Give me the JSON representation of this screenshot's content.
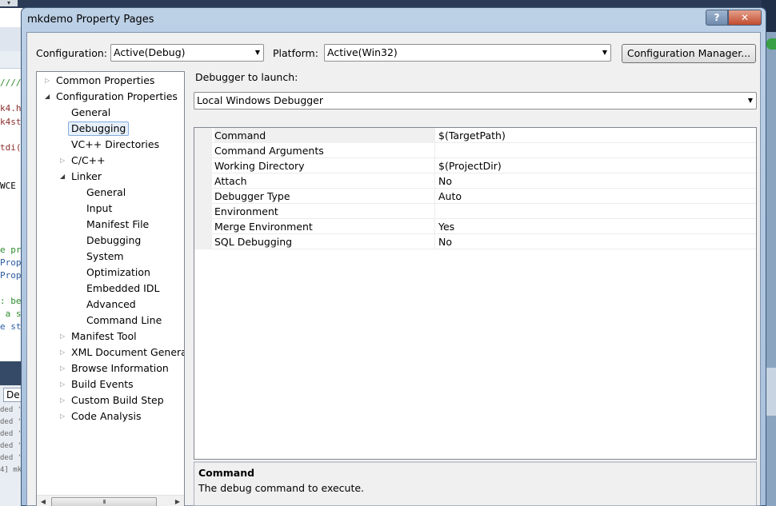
{
  "background": {
    "arrow": "▾",
    "code_lines": [
      "////",
      "k4.h",
      "k4st",
      "tdi(",
      "WCE",
      "e pr",
      "Prop",
      "Prop",
      ": be",
      " a s",
      "e st"
    ],
    "output_lines": [
      "ded '",
      "ded '",
      "ded '",
      "ded '",
      "ded '",
      "4] mk"
    ],
    "output_combo": "De"
  },
  "dialog": {
    "title": "mkdemo Property Pages",
    "help_label": "?",
    "close_label": "✕"
  },
  "config": {
    "configuration_label": "Configuration:",
    "configuration_value": "Active(Debug)",
    "platform_label": "Platform:",
    "platform_value": "Active(Win32)",
    "manager_button": "Configuration Manager..."
  },
  "tree": {
    "items": [
      {
        "label": "Common Properties",
        "twisty": "collapsed"
      },
      {
        "label": "Configuration Properties",
        "twisty": "expanded"
      },
      {
        "label": "General",
        "twisty": "none"
      },
      {
        "label": "Debugging",
        "twisty": "none",
        "selected": true
      },
      {
        "label": "VC++ Directories",
        "twisty": "none"
      },
      {
        "label": "C/C++",
        "twisty": "collapsed"
      },
      {
        "label": "Linker",
        "twisty": "expanded"
      },
      {
        "label": "General",
        "twisty": "none"
      },
      {
        "label": "Input",
        "twisty": "none"
      },
      {
        "label": "Manifest File",
        "twisty": "none"
      },
      {
        "label": "Debugging",
        "twisty": "none"
      },
      {
        "label": "System",
        "twisty": "none"
      },
      {
        "label": "Optimization",
        "twisty": "none"
      },
      {
        "label": "Embedded IDL",
        "twisty": "none"
      },
      {
        "label": "Advanced",
        "twisty": "none"
      },
      {
        "label": "Command Line",
        "twisty": "none"
      },
      {
        "label": "Manifest Tool",
        "twisty": "collapsed"
      },
      {
        "label": "XML Document Generat",
        "twisty": "collapsed"
      },
      {
        "label": "Browse Information",
        "twisty": "collapsed"
      },
      {
        "label": "Build Events",
        "twisty": "collapsed"
      },
      {
        "label": "Custom Build Step",
        "twisty": "collapsed"
      },
      {
        "label": "Code Analysis",
        "twisty": "collapsed"
      }
    ],
    "scroll_grip": "III"
  },
  "debugger": {
    "launch_label": "Debugger to launch:",
    "launch_value": "Local Windows Debugger"
  },
  "properties": [
    {
      "name": "Command",
      "value": "$(TargetPath)"
    },
    {
      "name": "Command Arguments",
      "value": ""
    },
    {
      "name": "Working Directory",
      "value": "$(ProjectDir)"
    },
    {
      "name": "Attach",
      "value": "No"
    },
    {
      "name": "Debugger Type",
      "value": "Auto"
    },
    {
      "name": "Environment",
      "value": ""
    },
    {
      "name": "Merge Environment",
      "value": "Yes"
    },
    {
      "name": "SQL Debugging",
      "value": "No"
    }
  ],
  "description": {
    "title": "Command",
    "text": "The debug command to execute."
  },
  "icons": {
    "dropdown": "▼",
    "expanded": "◢",
    "collapsed": "▷",
    "scroll_left": "◀",
    "scroll_right": "▶"
  }
}
